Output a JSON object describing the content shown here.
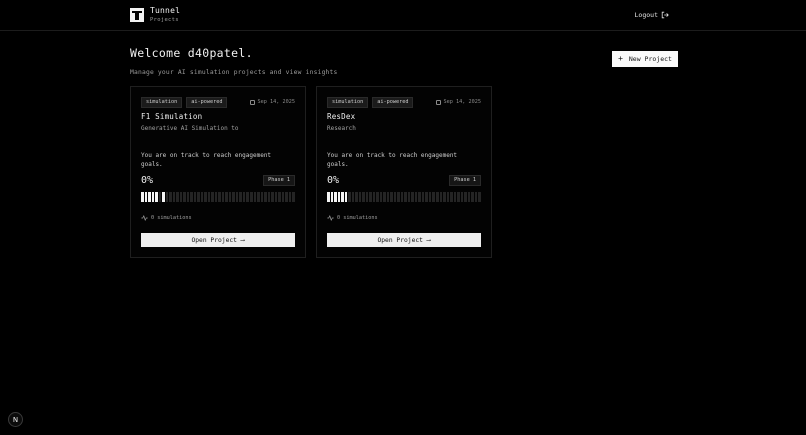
{
  "header": {
    "app_name": "Tunnel",
    "subtitle": "Projects",
    "logout_label": "Logout"
  },
  "welcome": {
    "title": "Welcome d40patel.",
    "subtitle": "Manage your AI simulation projects and view insights"
  },
  "new_project_label": "New Project",
  "projects": [
    {
      "tags": [
        "simulation",
        "ai-powered"
      ],
      "date": "Sep 14, 2025",
      "title": "F1 Simulation",
      "description": "Generative AI Simulation to",
      "goal": "You are on track to reach engagement goals.",
      "percent": "0%",
      "progress_fraction": 0.0,
      "phase": "Phase 1",
      "simulations": "0 simulations",
      "open_label": "Open Project ⟶"
    },
    {
      "tags": [
        "simulation",
        "ai-powered"
      ],
      "date": "Sep 14, 2025",
      "title": "ResDex",
      "description": "Research",
      "goal": "You are on track to reach engagement goals.",
      "percent": "0%",
      "progress_fraction": 0.0,
      "phase": "Phase 1",
      "simulations": "0 simulations",
      "open_label": "Open Project ⟶"
    }
  ],
  "corner_badge": "N"
}
